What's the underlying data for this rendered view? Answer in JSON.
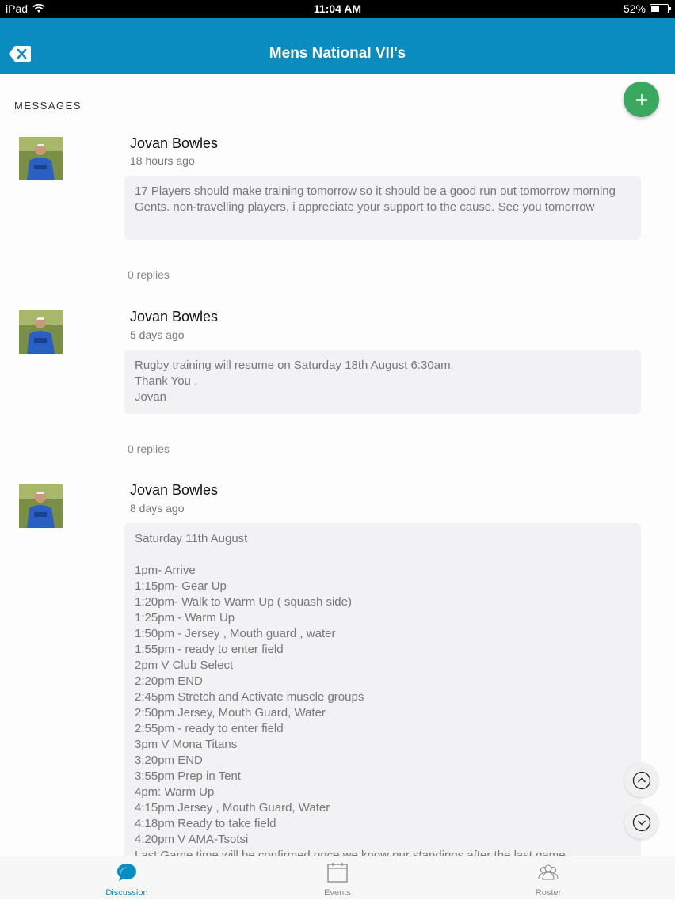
{
  "status_bar": {
    "device": "iPad",
    "time": "11:04 AM",
    "battery": "52%",
    "battery_level": 0.52
  },
  "nav": {
    "title": "Mens National VII's",
    "back_icon": "close-back-icon"
  },
  "section_title": "MESSAGES",
  "add_icon": "plus-icon",
  "messages": [
    {
      "author": "Jovan Bowles",
      "time": "18 hours ago",
      "body": "17 Players should make training tomorrow so it should be a good run out tomorrow morning Gents. non-travelling players, i appreciate your support to the cause. See you tomorrow",
      "replies": "0 replies"
    },
    {
      "author": "Jovan Bowles",
      "time": "5 days ago",
      "body": "Rugby training will resume on Saturday 18th August 6:30am.\nThank You .\nJovan",
      "replies": "0 replies"
    },
    {
      "author": "Jovan Bowles",
      "time": "8 days ago",
      "body": "Saturday 11th August\n\n1pm- Arrive\n1:15pm- Gear Up\n1:20pm- Walk to Warm Up ( squash side)\n1:25pm - Warm Up\n1:50pm - Jersey , Mouth guard , water\n1:55pm - ready to enter field\n2pm V Club Select\n2:20pm END\n2:45pm Stretch and Activate muscle groups\n2:50pm Jersey, Mouth Guard, Water\n2:55pm - ready to enter field\n3pm V Mona Titans\n3:20pm END\n3:55pm Prep in Tent\n4pm: Warm Up\n4:15pm Jersey , Mouth Guard, Water\n4:18pm Ready to take field\n4:20pm V AMA-Tsotsi\nLast Game time will be confirmed once we know our standings after the last game"
    }
  ],
  "tabs": [
    {
      "label": "Discussion",
      "icon": "chat-bubble-icon",
      "active": true
    },
    {
      "label": "Events",
      "icon": "calendar-icon",
      "active": false
    },
    {
      "label": "Roster",
      "icon": "people-icon",
      "active": false
    }
  ],
  "colors": {
    "accent": "#0a8cc0",
    "add_button": "#3aa85e",
    "bubble": "#f2f2f4"
  }
}
